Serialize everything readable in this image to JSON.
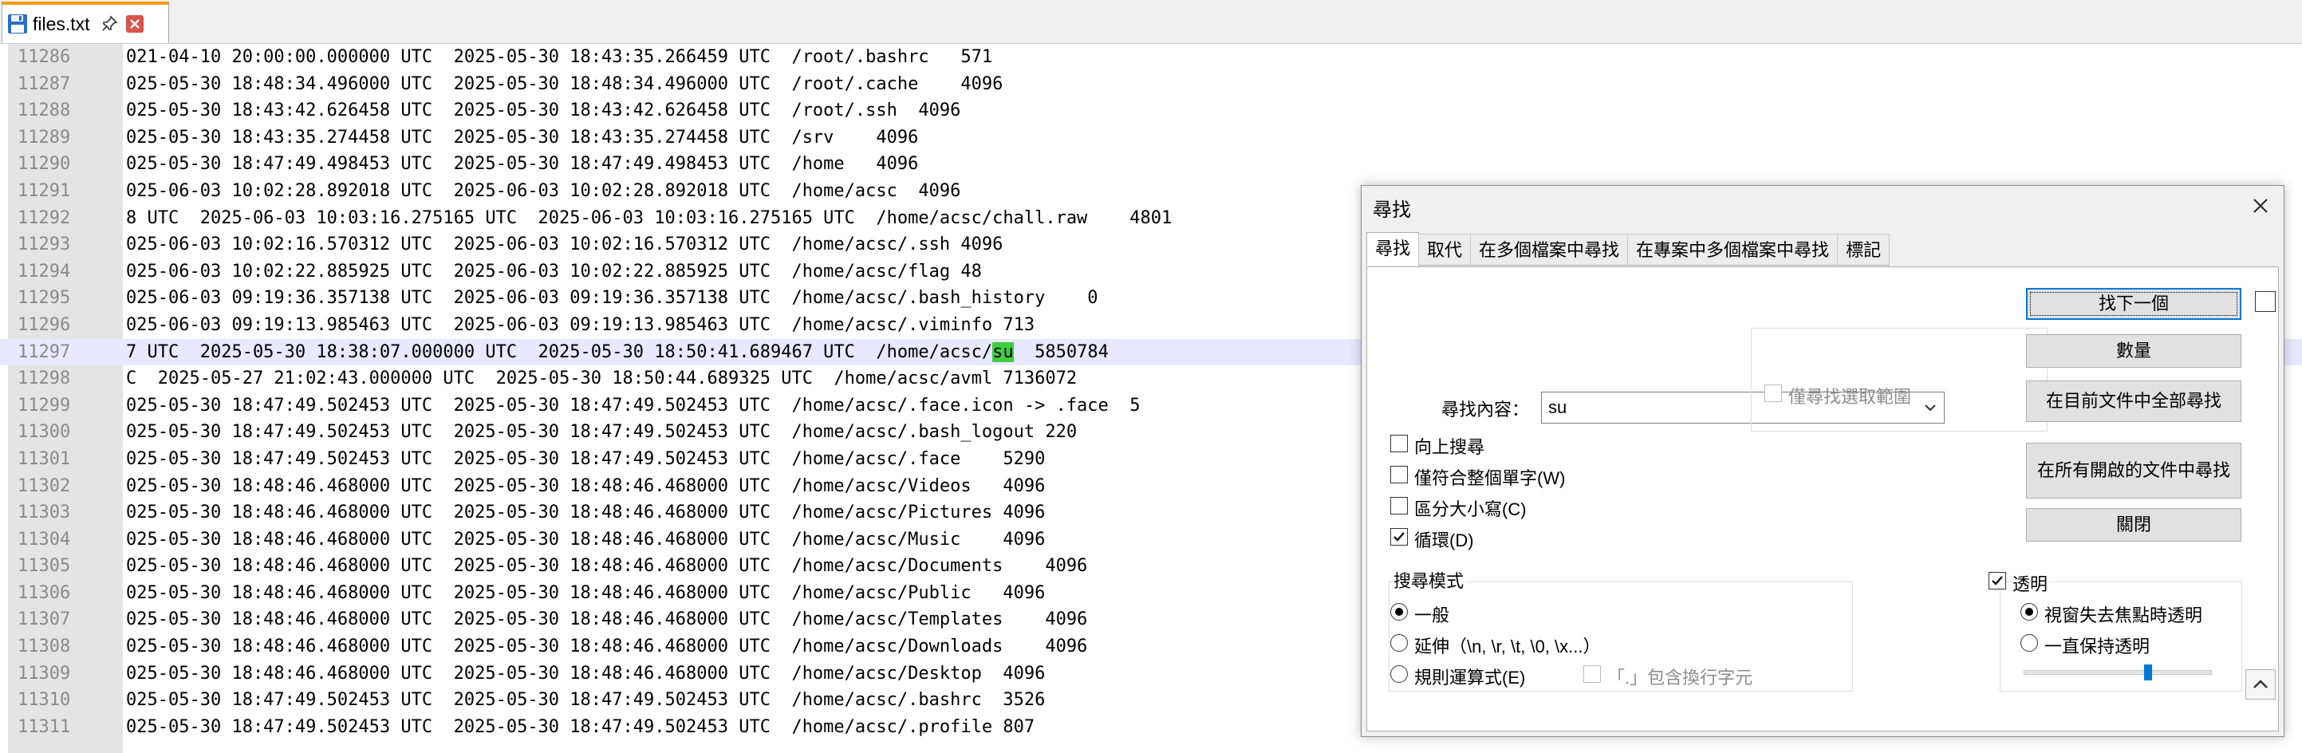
{
  "tab": {
    "label": "files.txt"
  },
  "editor": {
    "lines": [
      {
        "num": "11286",
        "text": "021-04-10 20:00:00.000000 UTC  2025-05-30 18:43:35.266459 UTC  /root/.bashrc   571"
      },
      {
        "num": "11287",
        "text": "025-05-30 18:48:34.496000 UTC  2025-05-30 18:48:34.496000 UTC  /root/.cache    4096"
      },
      {
        "num": "11288",
        "text": "025-05-30 18:43:42.626458 UTC  2025-05-30 18:43:42.626458 UTC  /root/.ssh  4096"
      },
      {
        "num": "11289",
        "text": "025-05-30 18:43:35.274458 UTC  2025-05-30 18:43:35.274458 UTC  /srv    4096"
      },
      {
        "num": "11290",
        "text": "025-05-30 18:47:49.498453 UTC  2025-05-30 18:47:49.498453 UTC  /home   4096"
      },
      {
        "num": "11291",
        "text": "025-06-03 10:02:28.892018 UTC  2025-06-03 10:02:28.892018 UTC  /home/acsc  4096"
      },
      {
        "num": "11292",
        "text": "8 UTC  2025-06-03 10:03:16.275165 UTC  2025-06-03 10:03:16.275165 UTC  /home/acsc/chall.raw    4801"
      },
      {
        "num": "11293",
        "text": "025-06-03 10:02:16.570312 UTC  2025-06-03 10:02:16.570312 UTC  /home/acsc/.ssh 4096"
      },
      {
        "num": "11294",
        "text": "025-06-03 10:02:22.885925 UTC  2025-06-03 10:02:22.885925 UTC  /home/acsc/flag 48"
      },
      {
        "num": "11295",
        "text": "025-06-03 09:19:36.357138 UTC  2025-06-03 09:19:36.357138 UTC  /home/acsc/.bash_history    0"
      },
      {
        "num": "11296",
        "text": "025-06-03 09:19:13.985463 UTC  2025-06-03 09:19:13.985463 UTC  /home/acsc/.viminfo 713"
      },
      {
        "num": "11297",
        "pre": "7 UTC  2025-05-30 18:38:07.000000 UTC  2025-05-30 18:50:41.689467 UTC  /home/acsc/",
        "match": "su",
        "post": "  5850784"
      },
      {
        "num": "11298",
        "text": "C  2025-05-27 21:02:43.000000 UTC  2025-05-30 18:50:44.689325 UTC  /home/acsc/avml 7136072"
      },
      {
        "num": "11299",
        "text": "025-05-30 18:47:49.502453 UTC  2025-05-30 18:47:49.502453 UTC  /home/acsc/.face.icon -> .face  5"
      },
      {
        "num": "11300",
        "text": "025-05-30 18:47:49.502453 UTC  2025-05-30 18:47:49.502453 UTC  /home/acsc/.bash_logout 220"
      },
      {
        "num": "11301",
        "text": "025-05-30 18:47:49.502453 UTC  2025-05-30 18:47:49.502453 UTC  /home/acsc/.face    5290"
      },
      {
        "num": "11302",
        "text": "025-05-30 18:48:46.468000 UTC  2025-05-30 18:48:46.468000 UTC  /home/acsc/Videos   4096"
      },
      {
        "num": "11303",
        "text": "025-05-30 18:48:46.468000 UTC  2025-05-30 18:48:46.468000 UTC  /home/acsc/Pictures 4096"
      },
      {
        "num": "11304",
        "text": "025-05-30 18:48:46.468000 UTC  2025-05-30 18:48:46.468000 UTC  /home/acsc/Music    4096"
      },
      {
        "num": "11305",
        "text": "025-05-30 18:48:46.468000 UTC  2025-05-30 18:48:46.468000 UTC  /home/acsc/Documents    4096"
      },
      {
        "num": "11306",
        "text": "025-05-30 18:48:46.468000 UTC  2025-05-30 18:48:46.468000 UTC  /home/acsc/Public   4096"
      },
      {
        "num": "11307",
        "text": "025-05-30 18:48:46.468000 UTC  2025-05-30 18:48:46.468000 UTC  /home/acsc/Templates    4096"
      },
      {
        "num": "11308",
        "text": "025-05-30 18:48:46.468000 UTC  2025-05-30 18:48:46.468000 UTC  /home/acsc/Downloads    4096"
      },
      {
        "num": "11309",
        "text": "025-05-30 18:48:46.468000 UTC  2025-05-30 18:48:46.468000 UTC  /home/acsc/Desktop  4096"
      },
      {
        "num": "11310",
        "text": "025-05-30 18:47:49.502453 UTC  2025-05-30 18:47:49.502453 UTC  /home/acsc/.bashrc  3526"
      },
      {
        "num": "11311",
        "text": "025-05-30 18:47:49.502453 UTC  2025-05-30 18:47:49.502453 UTC  /home/acsc/.profile 807"
      }
    ]
  },
  "dialog": {
    "title": "尋找",
    "tabs": [
      "尋找",
      "取代",
      "在多個檔案中尋找",
      "在專案中多個檔案中尋找",
      "標記"
    ],
    "find_label": "尋找內容：",
    "find_value": "su",
    "in_selection_label": "僅尋找選取範圍",
    "buttons": {
      "find_next": "找下一個",
      "count": "數量",
      "find_all_current": "在目前文件中全部尋找",
      "find_all_open": "在所有開啟的文件中尋找",
      "close": "關閉"
    },
    "options": {
      "backward": "向上搜尋",
      "whole_word": "僅符合整個單字(W)",
      "match_case": "區分大小寫(C)",
      "wrap": "循環(D)"
    },
    "search_mode": {
      "title": "搜尋模式",
      "normal": "一般",
      "extended": "延伸（\\n, \\r, \\t, \\0, \\x...）",
      "regex": "規則運算式(E)",
      "dot_newline": "「.」包含換行字元"
    },
    "transparency": {
      "title": "透明",
      "on_lose_focus": "視窗失去焦點時透明",
      "always": "一直保持透明",
      "level": 0.66
    }
  }
}
